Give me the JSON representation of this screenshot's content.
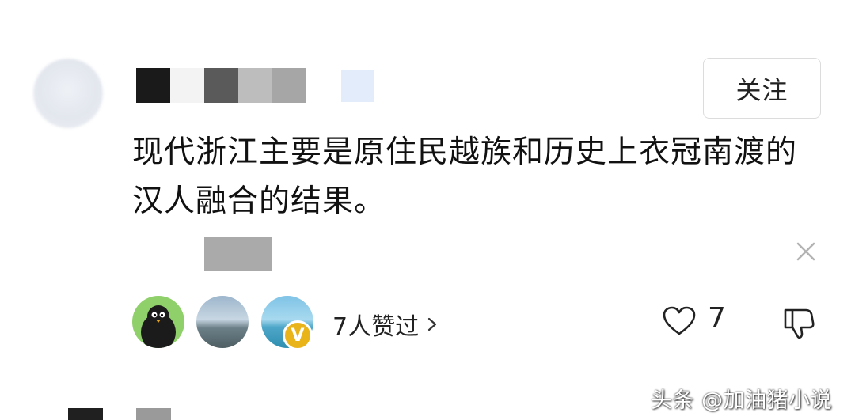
{
  "comment": {
    "text": "现代浙江主要是原住民越族和历史上衣冠南渡的汉人融合的结果。",
    "follow_label": "关注",
    "username_mosaic_colors": [
      "#1a1a1a",
      "#f3f3f3",
      "#5a5a5a",
      "#bdbdbd",
      "#a6a6a6"
    ]
  },
  "likers": {
    "label": "7人赞过",
    "avatars": [
      "penguin-avatar",
      "seaside-avatar",
      "beach-avatar"
    ],
    "vip_badge": "V"
  },
  "actions": {
    "like_count": "7"
  },
  "watermark": {
    "text": "头条 @加油猪小说"
  },
  "colors": {
    "vip_badge": "#e9b419",
    "text": "#111111",
    "border": "#dcdcdc"
  }
}
